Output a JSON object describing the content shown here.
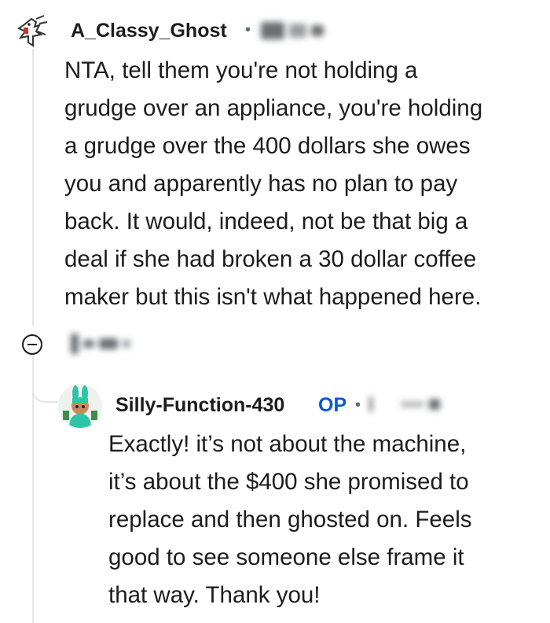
{
  "comment": {
    "username": "A_Classy_Ghost",
    "separator": "•",
    "body": "NTA, tell them you're not holding a\ngrudge over an appliance,  you're holding\na grudge over the 400 dollars she owes\nyou and apparently has no plan to pay\nback. It would, indeed, not be that big a\ndeal if she had broken a 30 dollar coffee\nmaker but this isn't what happened here.",
    "avatar_icon": "ghost-avatar-icon",
    "collapse_icon": "minus-circle-icon"
  },
  "reply": {
    "username": "Silly-Function-430",
    "op_badge": "OP",
    "separator": "•",
    "body": "Exactly! it’s not about the machine,\nit’s about the $400 she promised to\nreplace and then ghosted on. Feels\ngood to see someone else frame it\nthat way. Thank you!",
    "avatar_icon": "bunny-avatar-icon"
  },
  "colors": {
    "op_badge": "#0a58d6",
    "thread_line": "#e2e4e6",
    "text": "#1c1c1c"
  }
}
